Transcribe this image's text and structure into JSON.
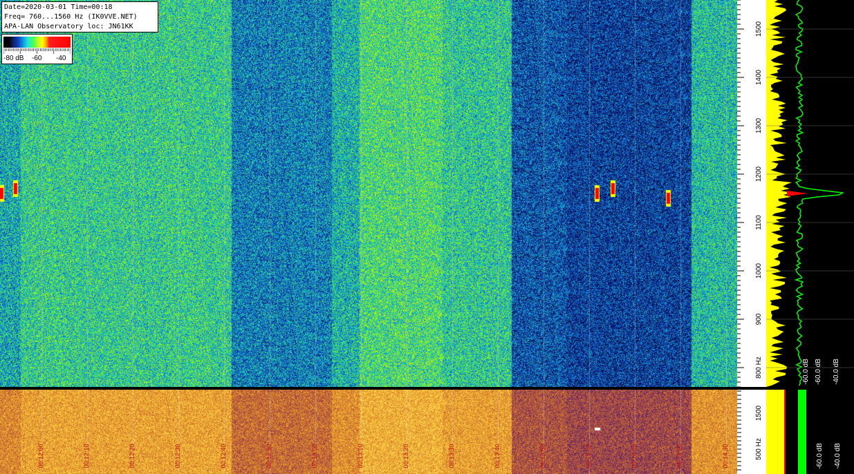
{
  "header": {
    "line1": "Date=2020-03-01 Time=00:18",
    "line2": "Freq= 760...1560 Hz (IK0VVE.NET)",
    "line3": "APA-LAN Observatory loc: JN61KK"
  },
  "color_scale": {
    "labels": [
      "-80 dB",
      "-60",
      "-40"
    ],
    "min_db": -80,
    "max_db": -40
  },
  "colors": {
    "background": "#000000",
    "spectrum_yellow": "#ffff00",
    "spectrum_green": "#00ff00",
    "signal_red": "#ff0000"
  },
  "chart_data": [
    {
      "type": "heatmap",
      "name": "upper-waterfall",
      "y_unit": "Hz",
      "ylim": [
        760,
        1560
      ],
      "y_ticks": [
        800,
        900,
        1000,
        1100,
        1200,
        1300,
        1400,
        1500
      ],
      "y_tick_labels": [
        "800 Hz",
        "900",
        "1000",
        "1100",
        "1200",
        "1300",
        "1400",
        "1500"
      ],
      "signals_hz": [
        1160,
        1170,
        1150
      ],
      "palette": "blue-green-yellow-red"
    },
    {
      "type": "line",
      "name": "spectrum-profile",
      "xlim": [
        -80,
        -40
      ],
      "x_tick_labels": [
        "-60.0 dB",
        "-60.0 dB",
        "-40.0 dB"
      ],
      "peak_hz": 1160
    },
    {
      "type": "heatmap",
      "name": "lower-waterfall",
      "y_tick_labels": [
        "500 Hz",
        "1500"
      ],
      "x_tick_labels": [
        "00:12:00",
        "00:12:10",
        "00:12:20",
        "00:12:30",
        "00:12:40",
        "00:12:50",
        "00:13:00",
        "00:13:10",
        "00:13:20",
        "00:13:30",
        "00:13:40",
        "00:13:50",
        "00:14:00",
        "00:14:10",
        "00:14:20",
        "00:14:30"
      ],
      "lower_x_tick_labels": [
        "-60.0 dB",
        "-40.0 dB"
      ],
      "palette": "purple-orange-yellow"
    }
  ]
}
